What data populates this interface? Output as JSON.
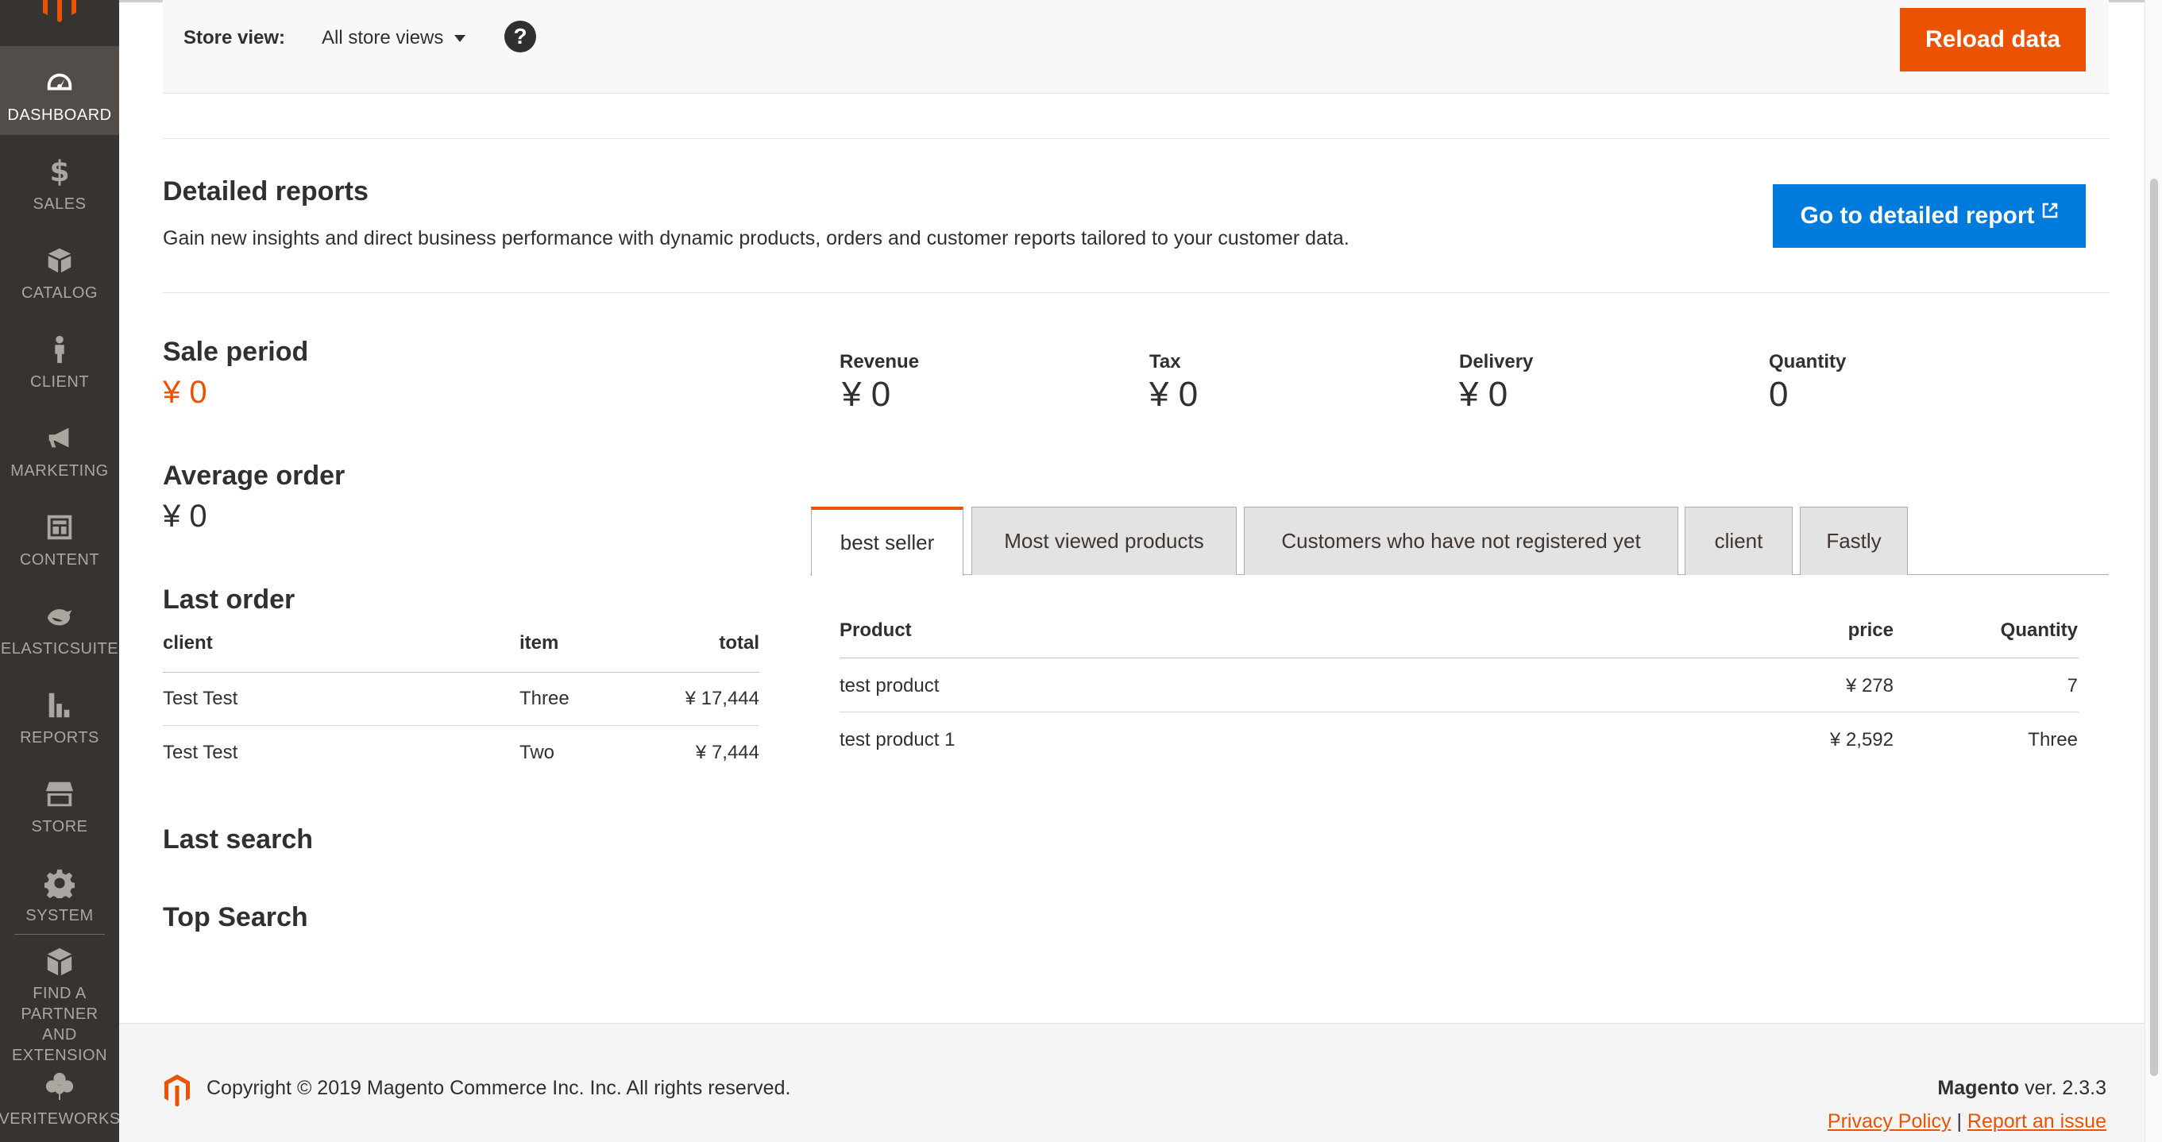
{
  "sidebar": {
    "items": [
      {
        "label": "DASHBOARD",
        "icon": "dashboard-icon"
      },
      {
        "label": "SALES",
        "icon": "dollar-icon"
      },
      {
        "label": "CATALOG",
        "icon": "box-icon"
      },
      {
        "label": "CLIENT",
        "icon": "person-icon"
      },
      {
        "label": "MARKETING",
        "icon": "megaphone-icon"
      },
      {
        "label": "CONTENT",
        "icon": "layout-icon"
      },
      {
        "label": "ELASTICSUITE",
        "icon": "elasticsuite-icon"
      },
      {
        "label": "REPORTS",
        "icon": "bar-chart-icon"
      },
      {
        "label": "STORE",
        "icon": "storefront-icon"
      },
      {
        "label": "SYSTEM",
        "icon": "gear-icon"
      },
      {
        "label": "FIND A PARTNER AND EXTENSION",
        "icon": "extensions-icon"
      },
      {
        "label": "VERITEWORKS",
        "icon": "clover-icon"
      }
    ]
  },
  "store_view": {
    "label": "Store view:",
    "selected": "All store views",
    "help": "?"
  },
  "reload_button": "Reload data",
  "detailed_reports": {
    "title": "Detailed reports",
    "description": "Gain new insights and direct business performance with dynamic products, orders and customer reports tailored to your customer data.",
    "button": "Go to detailed report"
  },
  "sale_period": {
    "label": "Sale period",
    "value": "¥ 0"
  },
  "average_order": {
    "label": "Average order",
    "value": "¥ 0"
  },
  "totals": {
    "revenue": {
      "label": "Revenue",
      "value": "¥ 0"
    },
    "tax": {
      "label": "Tax",
      "value": "¥ 0"
    },
    "delivery": {
      "label": "Delivery",
      "value": "¥ 0"
    },
    "quantity": {
      "label": "Quantity",
      "value": "0"
    }
  },
  "last_order": {
    "title": "Last order",
    "columns": [
      "client",
      "item",
      "total"
    ],
    "rows": [
      {
        "client": "Test Test",
        "item": "Three",
        "total": "¥ 17,444"
      },
      {
        "client": "Test Test",
        "item": "Two",
        "total": "¥ 7,444"
      }
    ]
  },
  "last_search": {
    "title": "Last search"
  },
  "top_search": {
    "title": "Top Search"
  },
  "tabs": [
    {
      "label": "best seller",
      "active": true
    },
    {
      "label": "Most viewed products",
      "active": false
    },
    {
      "label": "Customers who have not registered yet",
      "active": false
    },
    {
      "label": "client",
      "active": false
    },
    {
      "label": "Fastly",
      "active": false
    }
  ],
  "best_seller": {
    "columns": [
      "Product",
      "price",
      "Quantity"
    ],
    "rows": [
      {
        "product": "test product",
        "price": "¥ 278",
        "quantity": "7"
      },
      {
        "product": "test product 1",
        "price": "¥ 2,592",
        "quantity": "Three"
      }
    ]
  },
  "footer": {
    "copyright": "Copyright © 2019 Magento Commerce Inc. Inc. All rights reserved.",
    "brand": "Magento",
    "version": "ver. 2.3.3",
    "privacy": "Privacy Policy",
    "separator": "|",
    "report_issue": "Report an issue"
  },
  "colors": {
    "accent": "#eb5202",
    "primary_button": "#007bdb",
    "sidebar_bg": "#373330"
  }
}
